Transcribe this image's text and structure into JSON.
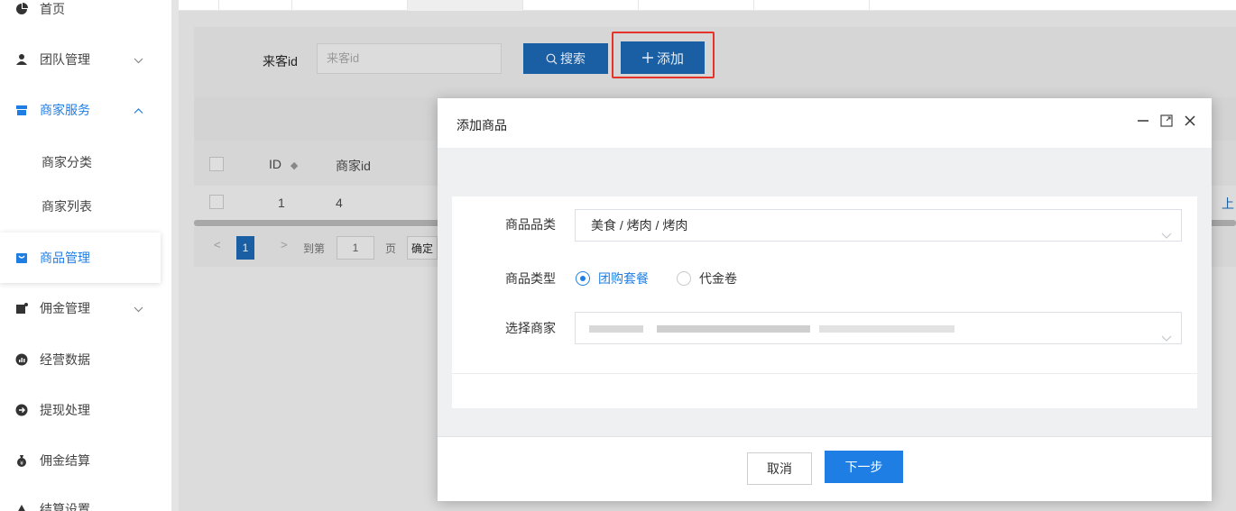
{
  "sidebar": {
    "items": [
      {
        "label": "首页",
        "icon": "pie-chart-icon"
      },
      {
        "label": "团队管理",
        "icon": "user-icon"
      },
      {
        "label": "商家服务",
        "icon": "store-icon"
      },
      {
        "label": "商家分类"
      },
      {
        "label": "商家列表"
      },
      {
        "label": "商品管理",
        "icon": "bag-icon"
      },
      {
        "label": "佣金管理",
        "icon": "wallet-icon"
      },
      {
        "label": "经营数据",
        "icon": "chart-icon"
      },
      {
        "label": "提现处理",
        "icon": "withdraw-icon"
      },
      {
        "label": "佣金结算",
        "icon": "money-bag-icon"
      },
      {
        "label": "结算设置",
        "icon": "settings-icon"
      }
    ]
  },
  "search": {
    "label": "来客id",
    "placeholder": "来客id",
    "search_button": "搜索",
    "add_button": "添加"
  },
  "table": {
    "columns": [
      "ID",
      "商家id"
    ],
    "rows": [
      {
        "id": "1",
        "merchant_id": "4"
      }
    ],
    "right_link": "上"
  },
  "pager": {
    "current": "1",
    "goto_label": "到第",
    "goto_value": "1",
    "page_label": "页",
    "confirm": "确定"
  },
  "modal": {
    "title": "添加商品",
    "category_label": "商品品类",
    "category_value": "美食 / 烤肉 / 烤肉",
    "type_label": "商品类型",
    "type_options": [
      "团购套餐",
      "代金卷"
    ],
    "type_selected": "团购套餐",
    "merchant_label": "选择商家",
    "cancel": "取消",
    "next": "下一步"
  },
  "colors": {
    "accent": "#1e7ee4",
    "overlay_button": "#1a5ea3",
    "highlight": "#e5332a"
  }
}
